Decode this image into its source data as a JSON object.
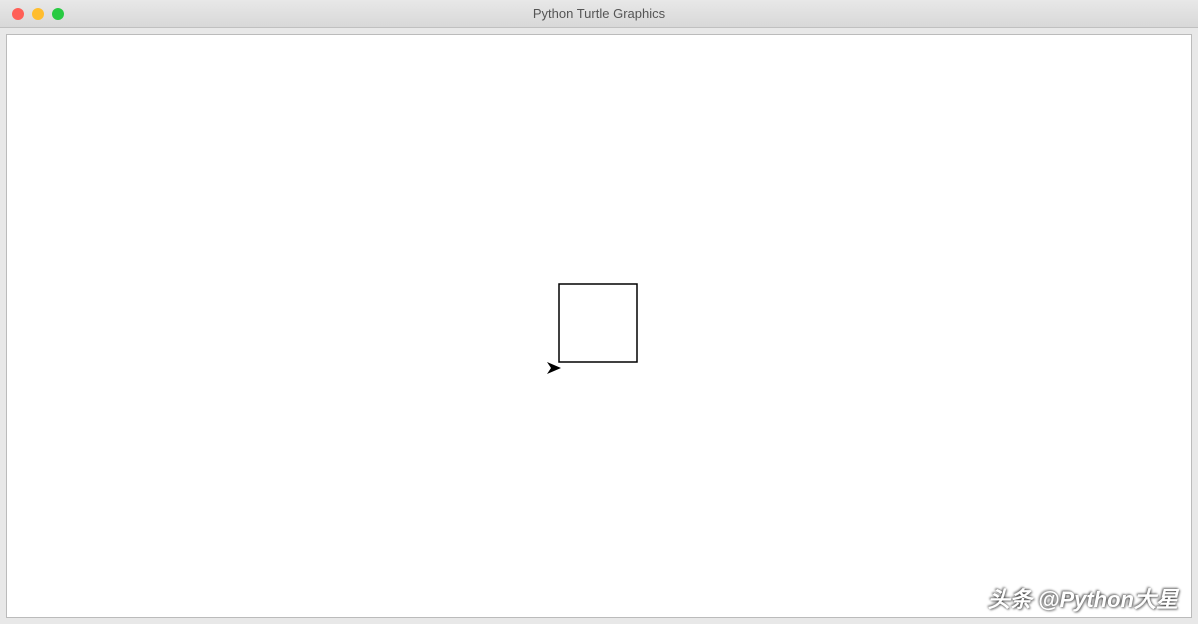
{
  "window": {
    "title": "Python Turtle Graphics"
  },
  "traffic_lights": {
    "close_color": "#ff5f57",
    "minimize_color": "#ffbd2e",
    "maximize_color": "#28ca42"
  },
  "turtle": {
    "shape": "square",
    "square_size": 78,
    "cursor_direction": "right",
    "cursor_position": "bottom-left-of-square"
  },
  "watermark": {
    "text": "头条 @Python大星"
  }
}
